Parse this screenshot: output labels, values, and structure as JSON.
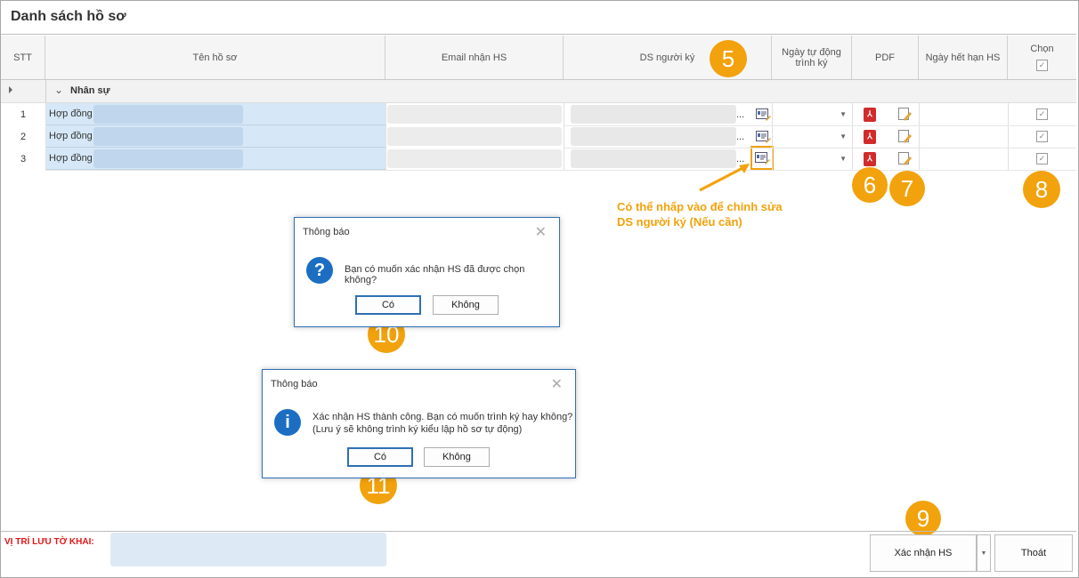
{
  "window": {
    "title": "Danh sách hồ sơ"
  },
  "grid": {
    "columns": {
      "stt": "STT",
      "ten_ho_so": "Tên hồ sơ",
      "email": "Email nhận HS",
      "ds_nguoi_ky": "DS người ký",
      "ngay_tu_dong_line1": "Ngày tự động",
      "ngay_tu_dong_line2": "trình ký",
      "pdf": "PDF",
      "ngay_het_han": "Ngày hết hạn HS",
      "chon": "Chọn"
    },
    "group_label": "Nhân sự",
    "rows": [
      {
        "stt": "1",
        "ten": "Hợp đồng",
        "ds_suffix": "...",
        "checked": "✓"
      },
      {
        "stt": "2",
        "ten": "Hợp đồng",
        "ds_suffix": "...",
        "checked": "✓"
      },
      {
        "stt": "3",
        "ten": "Hợp đồng",
        "ds_suffix": "...",
        "checked": "✓"
      }
    ],
    "header_check": "✓"
  },
  "callouts": {
    "n5": "5",
    "n6": "6",
    "n7": "7",
    "n8": "8",
    "n9": "9",
    "n10": "10",
    "n11": "11"
  },
  "annotation": {
    "line1": "Có thể nhấp vào để chỉnh sửa",
    "line2": "DS người ký (Nếu cần)"
  },
  "dialog1": {
    "title": "Thông báo",
    "icon": "?",
    "message": "Bạn có muốn xác nhận HS đã được chọn không?",
    "yes": "Có",
    "no": "Không"
  },
  "dialog2": {
    "title": "Thông báo",
    "icon": "i",
    "message_line1": "Xác nhận HS thành công. Bạn có muốn trình ký hay không?",
    "message_line2": "(Lưu ý sẽ không trình ký kiểu lập hồ sơ tự động)",
    "yes": "Có",
    "no": "Không"
  },
  "footer": {
    "location_label": "VỊ TRÍ LƯU TỜ KHAI:",
    "confirm_button": "Xác nhận HS",
    "exit_button": "Thoát"
  },
  "colors": {
    "accent_orange": "#f2a20c",
    "selection_blue": "#d6e8f7",
    "dialog_border": "#2f6fb5",
    "label_red": "#e01818"
  }
}
